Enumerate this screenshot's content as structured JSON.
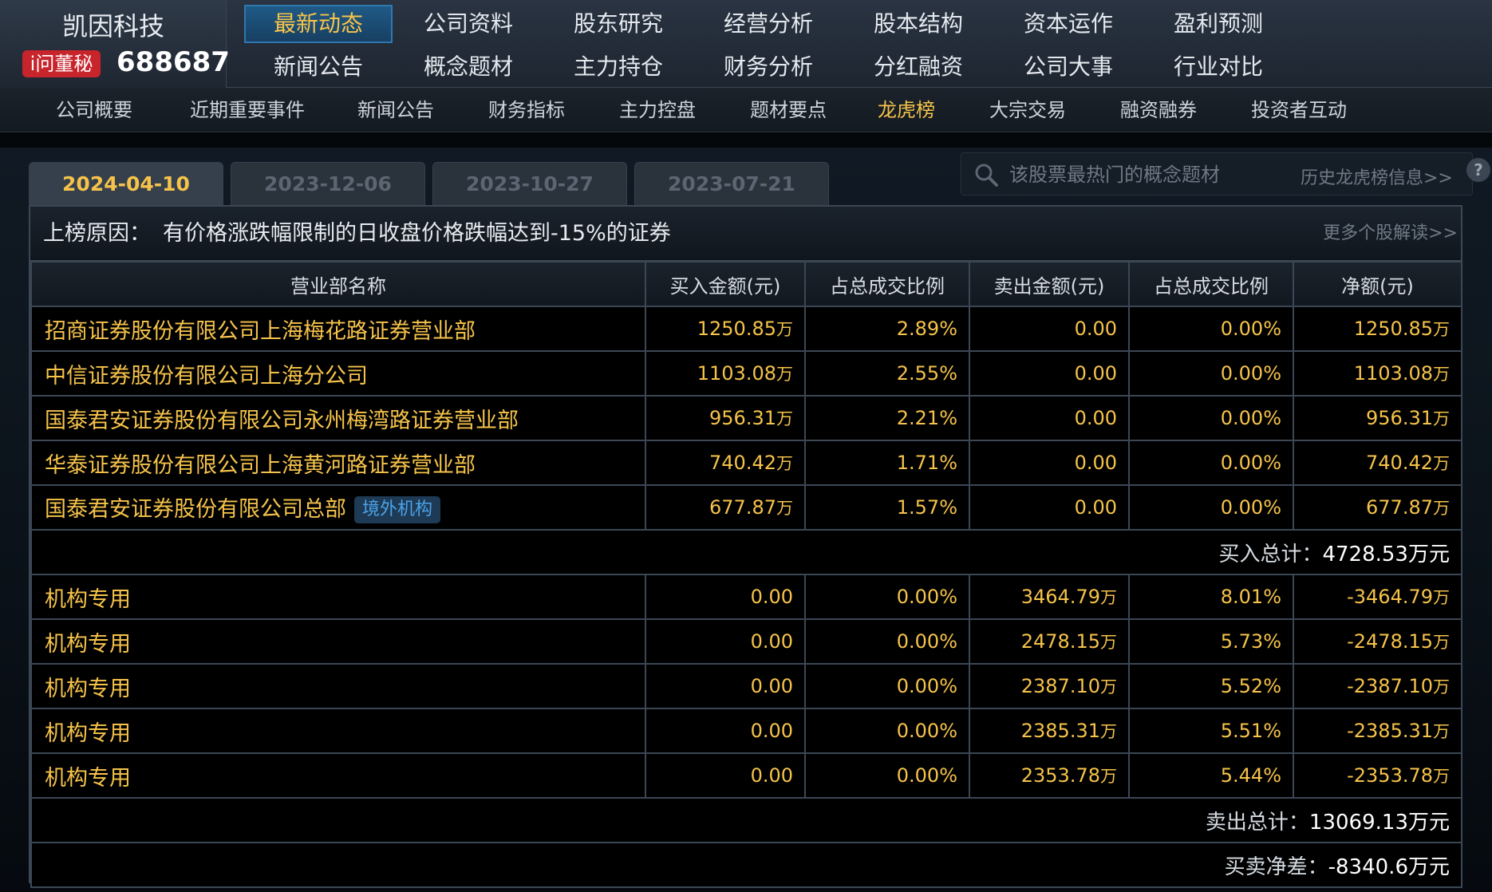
{
  "brand": {
    "company_name": "凯因科技",
    "badge": "i问董秘",
    "stock_code": "688687"
  },
  "main_nav": [
    {
      "label": "最新动态",
      "active": true
    },
    {
      "label": "公司资料",
      "active": false
    },
    {
      "label": "股东研究",
      "active": false
    },
    {
      "label": "经营分析",
      "active": false
    },
    {
      "label": "股本结构",
      "active": false
    },
    {
      "label": "资本运作",
      "active": false
    },
    {
      "label": "盈利预测",
      "active": false
    },
    {
      "label": "新闻公告",
      "active": false
    },
    {
      "label": "概念题材",
      "active": false
    },
    {
      "label": "主力持仓",
      "active": false
    },
    {
      "label": "财务分析",
      "active": false
    },
    {
      "label": "分红融资",
      "active": false
    },
    {
      "label": "公司大事",
      "active": false
    },
    {
      "label": "行业对比",
      "active": false
    }
  ],
  "sub_nav": [
    {
      "label": "公司概要",
      "active": false
    },
    {
      "label": "近期重要事件",
      "active": false
    },
    {
      "label": "新闻公告",
      "active": false
    },
    {
      "label": "财务指标",
      "active": false
    },
    {
      "label": "主力控盘",
      "active": false
    },
    {
      "label": "题材要点",
      "active": false
    },
    {
      "label": "龙虎榜",
      "active": true
    },
    {
      "label": "大宗交易",
      "active": false
    },
    {
      "label": "融资融券",
      "active": false
    },
    {
      "label": "投资者互动",
      "active": false
    }
  ],
  "date_tabs": [
    {
      "label": "2024-04-10",
      "active": true
    },
    {
      "label": "2023-12-06",
      "active": false
    },
    {
      "label": "2023-10-27",
      "active": false
    },
    {
      "label": "2023-07-21",
      "active": false
    }
  ],
  "search": {
    "placeholder": "该股票最热门的概念题材",
    "history_link": "历史龙虎榜信息>>"
  },
  "reason": {
    "label": "上榜原因：",
    "text": "有价格涨跌幅限制的日收盘价格跌幅达到-15%的证券",
    "more_link": "更多个股解读>>"
  },
  "table": {
    "headers": [
      "营业部名称",
      "买入金额(元)",
      "占总成交比例",
      "卖出金额(元)",
      "占总成交比例",
      "净额(元)"
    ],
    "buy_rows": [
      {
        "name": "招商证券股份有限公司上海梅花路证券营业部",
        "buy": "1250.85",
        "buy_pct": "2.89%",
        "sell": "0.00",
        "sell_pct": "0.00%",
        "net": "1250.85",
        "tag": ""
      },
      {
        "name": "中信证券股份有限公司上海分公司",
        "buy": "1103.08",
        "buy_pct": "2.55%",
        "sell": "0.00",
        "sell_pct": "0.00%",
        "net": "1103.08",
        "tag": ""
      },
      {
        "name": "国泰君安证券股份有限公司永州梅湾路证券营业部",
        "buy": "956.31",
        "buy_pct": "2.21%",
        "sell": "0.00",
        "sell_pct": "0.00%",
        "net": "956.31",
        "tag": ""
      },
      {
        "name": "华泰证券股份有限公司上海黄河路证券营业部",
        "buy": "740.42",
        "buy_pct": "1.71%",
        "sell": "0.00",
        "sell_pct": "0.00%",
        "net": "740.42",
        "tag": ""
      },
      {
        "name": "国泰君安证券股份有限公司总部",
        "buy": "677.87",
        "buy_pct": "1.57%",
        "sell": "0.00",
        "sell_pct": "0.00%",
        "net": "677.87",
        "tag": "境外机构"
      }
    ],
    "buy_total": {
      "label": "买入总计：",
      "value": "4728.53",
      "unit": "万元"
    },
    "sell_rows": [
      {
        "name": "机构专用",
        "buy": "0.00",
        "buy_pct": "0.00%",
        "sell": "3464.79",
        "sell_pct": "8.01%",
        "net": "-3464.79"
      },
      {
        "name": "机构专用",
        "buy": "0.00",
        "buy_pct": "0.00%",
        "sell": "2478.15",
        "sell_pct": "5.73%",
        "net": "-2478.15"
      },
      {
        "name": "机构专用",
        "buy": "0.00",
        "buy_pct": "0.00%",
        "sell": "2387.10",
        "sell_pct": "5.52%",
        "net": "-2387.10"
      },
      {
        "name": "机构专用",
        "buy": "0.00",
        "buy_pct": "0.00%",
        "sell": "2385.31",
        "sell_pct": "5.51%",
        "net": "-2385.31"
      },
      {
        "name": "机构专用",
        "buy": "0.00",
        "buy_pct": "0.00%",
        "sell": "2353.78",
        "sell_pct": "5.44%",
        "net": "-2353.78"
      }
    ],
    "sell_total": {
      "label": "卖出总计：",
      "value": "13069.13",
      "unit": "万元"
    },
    "net_total": {
      "label": "买卖净差：",
      "value": "-8340.6",
      "unit": "万元"
    },
    "wan_unit": "万"
  }
}
